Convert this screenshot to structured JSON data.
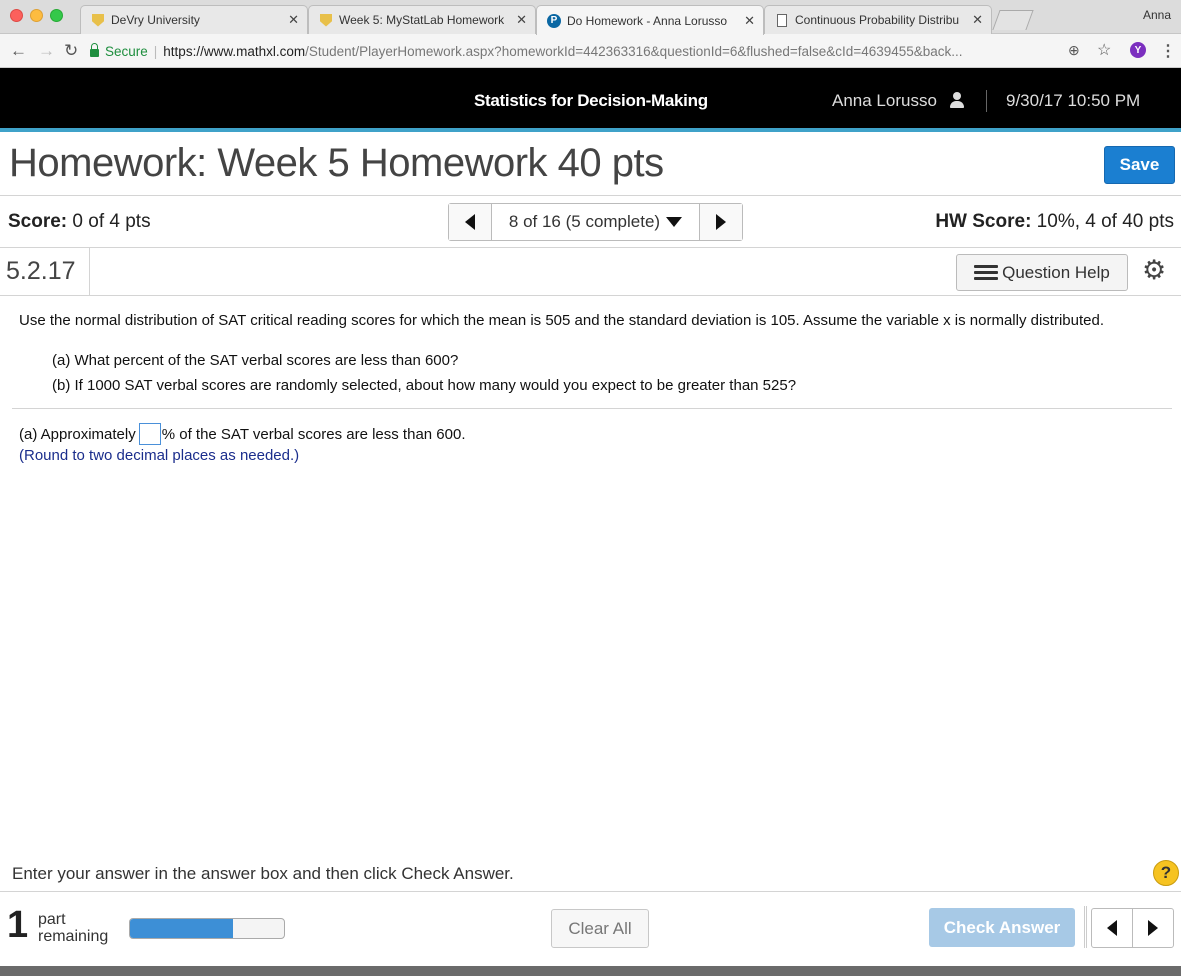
{
  "browser": {
    "profile_name": "Anna",
    "tabs": [
      {
        "label": "DeVry University",
        "favicon": "devry-shield",
        "active": false
      },
      {
        "label": "Week 5: MyStatLab Homework",
        "favicon": "devry-shield",
        "active": false
      },
      {
        "label": "Do Homework - Anna Lorusso",
        "favicon": "pearson-p",
        "active": true
      },
      {
        "label": "Continuous Probability Distribu",
        "favicon": "document",
        "active": false
      }
    ],
    "secure_label": "Secure",
    "url_host": "https://www.mathxl.com",
    "url_rest": "/Student/PlayerHomework.aspx?homeworkId=442363316&questionId=6&flushed=false&cId=4639455&back...",
    "extension_letter": "Y"
  },
  "header": {
    "course": "Statistics for Decision-Making",
    "user": "Anna Lorusso",
    "datetime": "9/30/17 10:50 PM"
  },
  "homework": {
    "title": "Homework: Week 5 Homework 40 pts",
    "save_label": "Save",
    "score_label": "Score:",
    "score_value": " 0 of 4 pts",
    "question_nav": "8 of 16 (5 complete)",
    "hw_score_label": "HW Score:",
    "hw_score_value": " 10%, 4 of 40 pts",
    "question_id": "5.2.17",
    "question_help": "Question Help"
  },
  "question": {
    "text": "Use the normal distribution of SAT critical reading scores for which the mean is 505 and the standard deviation is 105. Assume the variable x is normally distributed.",
    "part_a": "(a) What percent of the SAT verbal scores are less than 600?",
    "part_b": "(b) If 1000 SAT verbal scores are randomly selected, about how many would you expect to be greater than 525?",
    "answer_prefix": "(a) Approximately",
    "answer_value": "",
    "answer_suffix": "% of the SAT verbal scores are less than 600.",
    "hint": "(Round to two decimal places as needed.)"
  },
  "footer": {
    "instruction": "Enter your answer in the answer box and then click Check Answer.",
    "help_glyph": "?",
    "parts_count": "1",
    "parts_label_1": "part",
    "parts_label_2": "remaining",
    "progress_fraction": 0.67,
    "clear_label": "Clear All",
    "check_label": "Check Answer"
  },
  "colors": {
    "header_bg": "#000000",
    "header_accent": "#3fa2c9",
    "save_button": "#1b7fd1",
    "check_button_disabled": "#a7c9e6",
    "hint_text": "#1a2d8c",
    "help_circle": "#f6c321"
  }
}
